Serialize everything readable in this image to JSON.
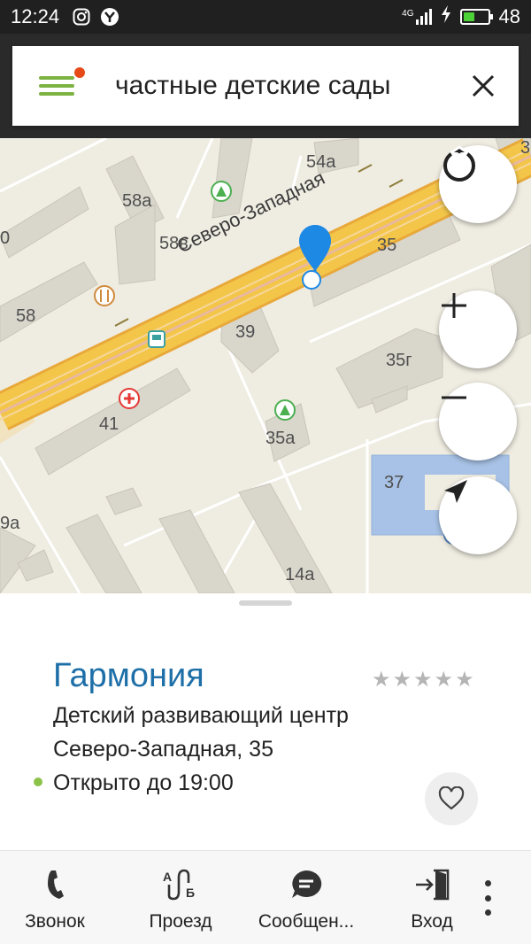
{
  "status_bar": {
    "time": "12:24",
    "network": "4G",
    "battery": "48",
    "battery_level": 0.48
  },
  "search": {
    "query": "частные детские сады",
    "icons": {
      "menu": "hamburger-menu-icon",
      "clear": "close-icon"
    }
  },
  "map": {
    "street_label": "Северо-Западная",
    "building_labels": [
      "54а",
      "58а",
      "58в",
      "58",
      "35",
      "39",
      "35г",
      "41",
      "35а",
      "37",
      "14а",
      "0",
      "9а",
      "3"
    ],
    "controls": [
      "compass-icon",
      "zoom-in-icon",
      "zoom-out-icon",
      "my-location-icon"
    ],
    "colors": {
      "road": "#f3c64a",
      "road_edge": "#e8a93a",
      "building": "#d9d6cc",
      "highlight": "#a7c2e6",
      "pin": "#1e88e5"
    }
  },
  "place": {
    "name": "Гармония",
    "category": "Детский развивающий центр",
    "address": "Северо-Западная, 35",
    "hours": "Открыто до 19:00",
    "rating": 0
  },
  "actions": {
    "call": "Звонок",
    "route": "Проезд",
    "message": "Сообщен...",
    "entrance": "Вход"
  }
}
